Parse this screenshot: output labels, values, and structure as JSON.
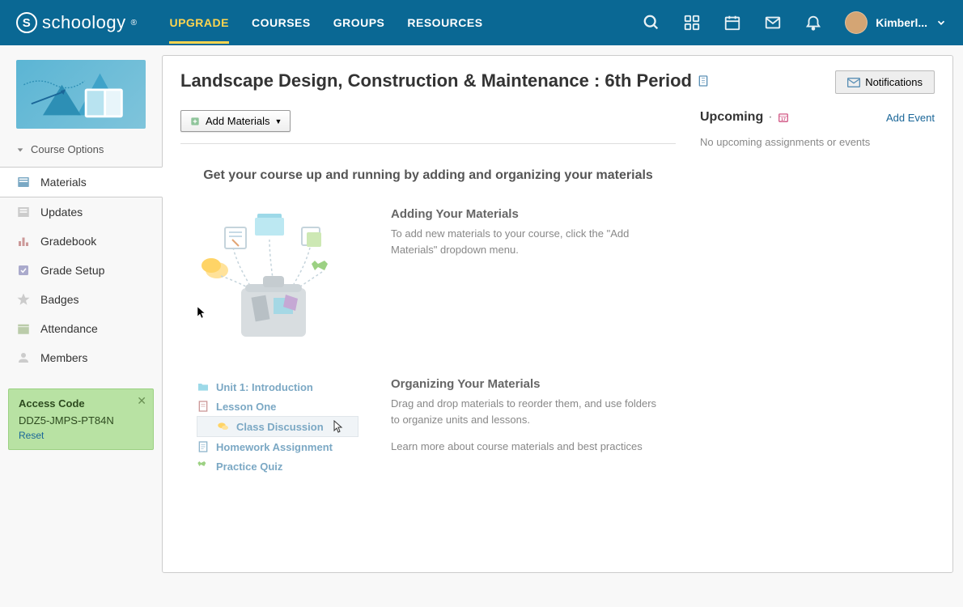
{
  "header": {
    "brand": "schoology",
    "nav": {
      "upgrade": "UPGRADE",
      "courses": "COURSES",
      "groups": "GROUPS",
      "resources": "RESOURCES"
    },
    "user_name": "Kimberl..."
  },
  "sidebar": {
    "course_options": "Course Options",
    "items": [
      {
        "label": "Materials"
      },
      {
        "label": "Updates"
      },
      {
        "label": "Gradebook"
      },
      {
        "label": "Grade Setup"
      },
      {
        "label": "Badges"
      },
      {
        "label": "Attendance"
      },
      {
        "label": "Members"
      }
    ],
    "access": {
      "title": "Access Code",
      "code": "DDZ5-JMPS-PT84N",
      "reset": "Reset"
    }
  },
  "page": {
    "title": "Landscape Design, Construction & Maintenance : 6th Period",
    "notifications": "Notifications",
    "add_materials": "Add Materials"
  },
  "onboard": {
    "heading": "Get your course up and running by adding and organizing your materials",
    "adding": {
      "title": "Adding Your Materials",
      "body": "To add new materials to your course, click the \"Add Materials\" dropdown menu."
    },
    "organizing": {
      "title": "Organizing Your Materials",
      "body": "Drag and drop materials to reorder them, and use folders to organize units and lessons.",
      "learn": "Learn more about course materials and best practices"
    },
    "samples": [
      "Unit 1: Introduction",
      "Lesson One",
      "Class Discussion",
      "Homework Assignment",
      "Practice Quiz"
    ]
  },
  "upcoming": {
    "title": "Upcoming",
    "add_event": "Add Event",
    "empty": "No upcoming assignments or events"
  }
}
